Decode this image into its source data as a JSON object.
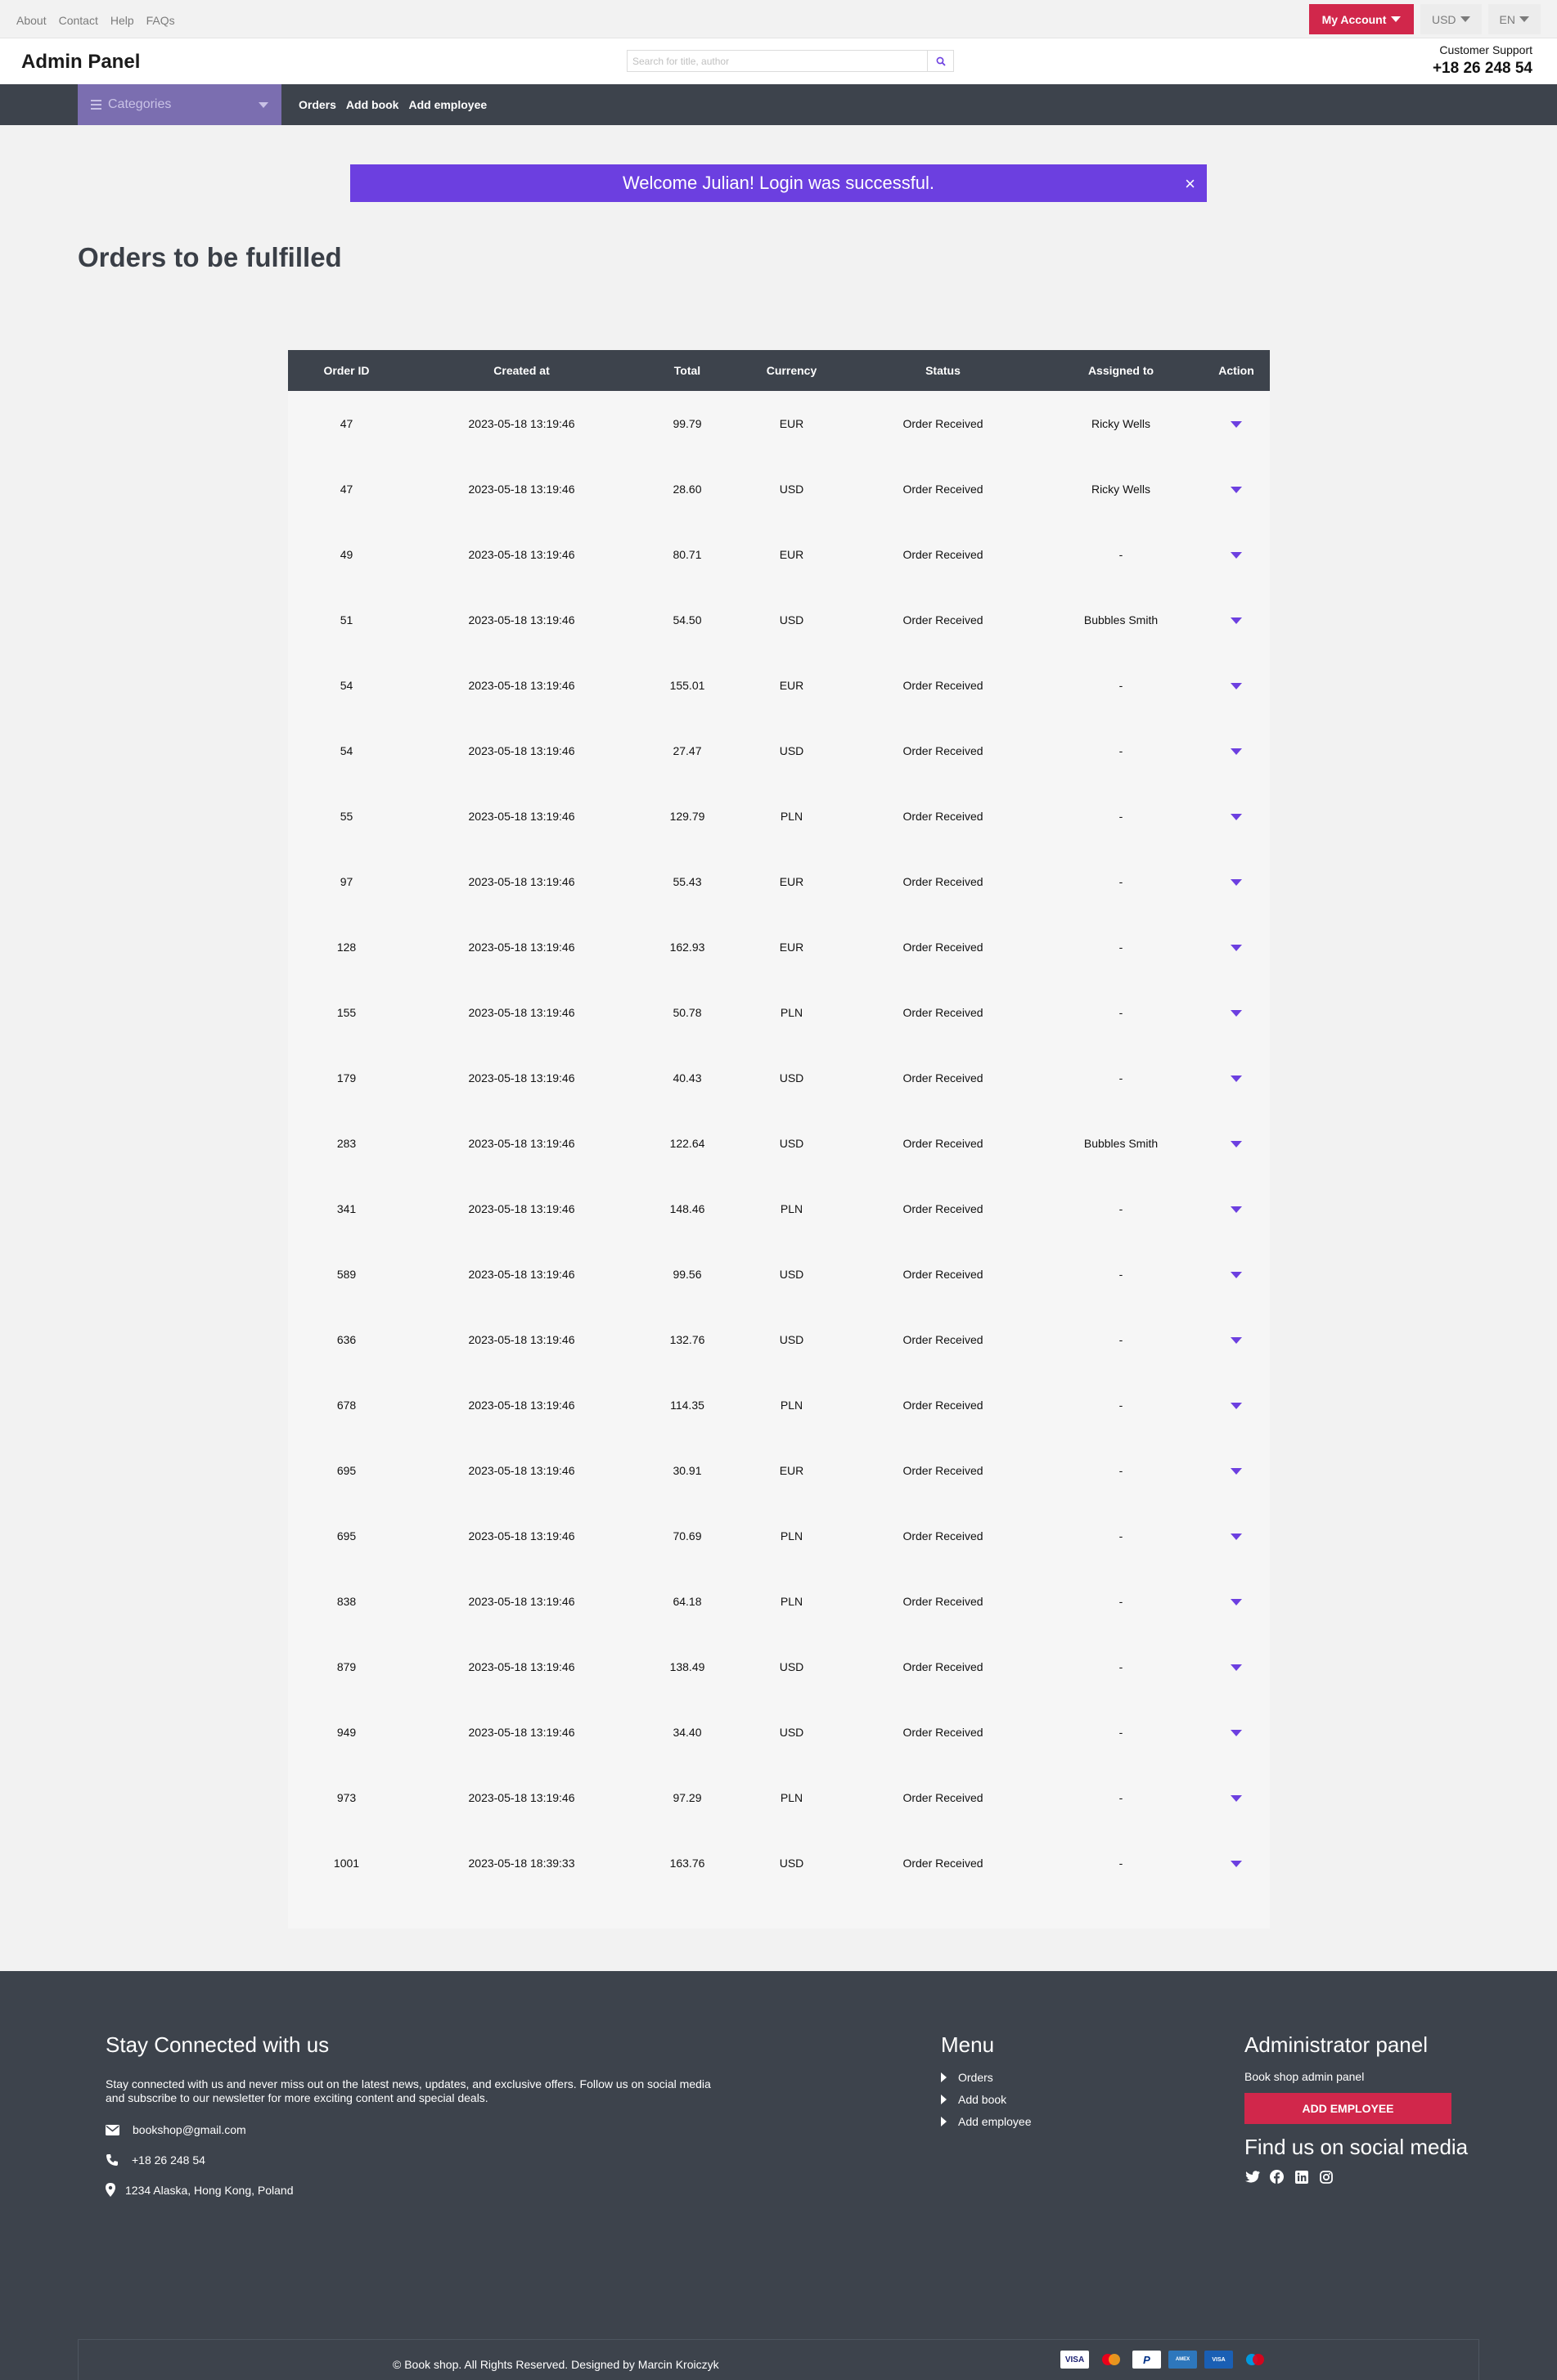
{
  "topbar": {
    "links": [
      "About",
      "Contact",
      "Help",
      "FAQs"
    ],
    "my_account": "My Account",
    "currency": "USD",
    "language": "EN"
  },
  "header": {
    "brand": "Admin Panel",
    "search_placeholder": "Search for title, author",
    "support_label": "Customer Support",
    "support_phone": "+18 26 248 54"
  },
  "nav": {
    "categories_label": "Categories",
    "links": [
      "Orders",
      "Add book",
      "Add employee"
    ]
  },
  "alert": {
    "message": "Welcome Julian! Login was successful.",
    "close": "×"
  },
  "page_title": "Orders to be fulfilled",
  "table": {
    "headers": [
      "Order ID",
      "Created at",
      "Total",
      "Currency",
      "Status",
      "Assigned to",
      "Action"
    ],
    "rows": [
      [
        "47",
        "2023-05-18 13:19:46",
        "99.79",
        "EUR",
        "Order Received",
        "Ricky Wells"
      ],
      [
        "47",
        "2023-05-18 13:19:46",
        "28.60",
        "USD",
        "Order Received",
        "Ricky Wells"
      ],
      [
        "49",
        "2023-05-18 13:19:46",
        "80.71",
        "EUR",
        "Order Received",
        "-"
      ],
      [
        "51",
        "2023-05-18 13:19:46",
        "54.50",
        "USD",
        "Order Received",
        "Bubbles Smith"
      ],
      [
        "54",
        "2023-05-18 13:19:46",
        "155.01",
        "EUR",
        "Order Received",
        "-"
      ],
      [
        "54",
        "2023-05-18 13:19:46",
        "27.47",
        "USD",
        "Order Received",
        "-"
      ],
      [
        "55",
        "2023-05-18 13:19:46",
        "129.79",
        "PLN",
        "Order Received",
        "-"
      ],
      [
        "97",
        "2023-05-18 13:19:46",
        "55.43",
        "EUR",
        "Order Received",
        "-"
      ],
      [
        "128",
        "2023-05-18 13:19:46",
        "162.93",
        "EUR",
        "Order Received",
        "-"
      ],
      [
        "155",
        "2023-05-18 13:19:46",
        "50.78",
        "PLN",
        "Order Received",
        "-"
      ],
      [
        "179",
        "2023-05-18 13:19:46",
        "40.43",
        "USD",
        "Order Received",
        "-"
      ],
      [
        "283",
        "2023-05-18 13:19:46",
        "122.64",
        "USD",
        "Order Received",
        "Bubbles Smith"
      ],
      [
        "341",
        "2023-05-18 13:19:46",
        "148.46",
        "PLN",
        "Order Received",
        "-"
      ],
      [
        "589",
        "2023-05-18 13:19:46",
        "99.56",
        "USD",
        "Order Received",
        "-"
      ],
      [
        "636",
        "2023-05-18 13:19:46",
        "132.76",
        "USD",
        "Order Received",
        "-"
      ],
      [
        "678",
        "2023-05-18 13:19:46",
        "114.35",
        "PLN",
        "Order Received",
        "-"
      ],
      [
        "695",
        "2023-05-18 13:19:46",
        "30.91",
        "EUR",
        "Order Received",
        "-"
      ],
      [
        "695",
        "2023-05-18 13:19:46",
        "70.69",
        "PLN",
        "Order Received",
        "-"
      ],
      [
        "838",
        "2023-05-18 13:19:46",
        "64.18",
        "PLN",
        "Order Received",
        "-"
      ],
      [
        "879",
        "2023-05-18 13:19:46",
        "138.49",
        "USD",
        "Order Received",
        "-"
      ],
      [
        "949",
        "2023-05-18 13:19:46",
        "34.40",
        "USD",
        "Order Received",
        "-"
      ],
      [
        "973",
        "2023-05-18 13:19:46",
        "97.29",
        "PLN",
        "Order Received",
        "-"
      ],
      [
        "1001",
        "2023-05-18 18:39:33",
        "163.76",
        "USD",
        "Order Received",
        "-"
      ]
    ]
  },
  "footer": {
    "stay_heading": "Stay Connected with us",
    "stay_text": "Stay connected with us and never miss out on the latest news, updates, and exclusive offers. Follow us on social media and subscribe to our newsletter for more exciting content and special deals.",
    "email": "bookshop@gmail.com",
    "phone": "+18 26 248 54",
    "address": "1234 Alaska, Hong Kong, Poland",
    "menu_heading": "Menu",
    "menu_items": [
      "Orders",
      "Add book",
      "Add employee"
    ],
    "admin_heading": "Administrator panel",
    "admin_sub": "Book shop admin panel",
    "add_employee": "ADD EMPLOYEE",
    "social_heading": "Find us on social media",
    "social_icons": [
      "twitter-icon",
      "facebook-icon",
      "linkedin-icon",
      "instagram-icon"
    ],
    "copyright": "© Book shop. All Rights Reserved. Designed by Marcin Kroiczyk",
    "payment_icons": [
      "visa-icon",
      "mastercard-icon",
      "paypal-icon",
      "amex-icon",
      "visa-electron-icon",
      "maestro-icon"
    ]
  },
  "colors": {
    "accent": "#6c3fe0",
    "brand_red": "#d1274b",
    "dark": "#3d434c",
    "categories_bg": "#7b6eb0"
  }
}
